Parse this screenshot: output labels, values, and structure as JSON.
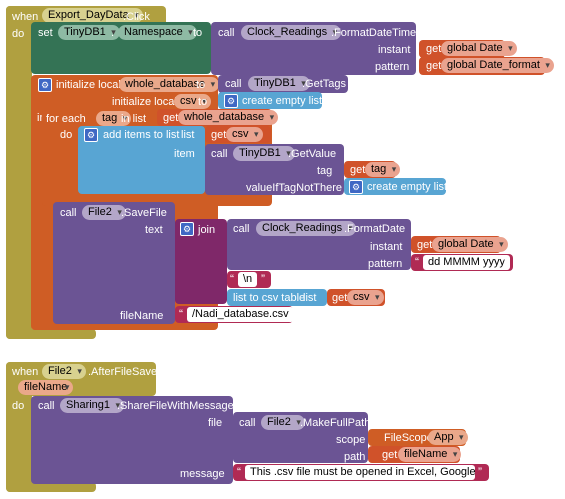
{
  "event1": {
    "when": "when",
    "component": "Export_DayData",
    "event": ".Click",
    "do": "do",
    "set_kw": "set",
    "set_component": "TinyDB1",
    "dot": ".",
    "set_property": "Namespace",
    "to_kw": "to",
    "call_kw": "call",
    "clock_component": "Clock_Readings",
    "clock_method": ".FormatDateTime",
    "instant_label": "instant",
    "pattern_label": "pattern",
    "get_kw": "get",
    "global_date": "global Date",
    "global_date_format": "global Date_format",
    "init_local": "initialize local",
    "var_whole": "whole_database",
    "get_tags_component": "TinyDB1",
    "get_tags_method": ".GetTags",
    "init_local2": "initialize local",
    "var_csv": "csv",
    "create_empty_list": "create empty list",
    "in_kw": "in",
    "for_each": "for each",
    "var_tag": "tag",
    "in_list": "in list",
    "add_items": "add items to list",
    "list_label": "list",
    "item_label": "item",
    "getvalue_component": "TinyDB1",
    "getvalue_method": ".GetValue",
    "tag_label": "tag",
    "value_if_not": "valueIfTagNotThere",
    "file_component": "File2",
    "savefile_method": ".SaveFile",
    "text_label": "text",
    "join_kw": "join",
    "formatdate_method": ".FormatDate",
    "date_pattern": "dd MMMM yyyy",
    "newline": "\\n",
    "list_to_csv": "list to csv table",
    "filename_label": "fileName",
    "filename_value": "/Nadi_database.csv"
  },
  "event2": {
    "when": "when",
    "component": "File2",
    "event": ".AfterFileSaved",
    "param": "fileName",
    "do": "do",
    "call_kw": "call",
    "sharing_component": "Sharing1",
    "sharing_method": ".ShareFileWithMessage",
    "file_label": "file",
    "file_component": "File2",
    "fullpath_method": ".MakeFullPath",
    "scope_label": "scope",
    "filescope": "FileScope",
    "scope_value": "App",
    "path_label": "path",
    "get_kw": "get",
    "get_filename": "fileName",
    "message_label": "message",
    "message_value": "This .csv file must be opened in Excel, GoogleSh..."
  },
  "colors": {
    "event": "#b0a040",
    "control": "#cf5d25",
    "component": "#6b5494",
    "database_set": "#347355",
    "list": "#58a5d3",
    "text": "#b02a54",
    "join": "#7f2869"
  }
}
